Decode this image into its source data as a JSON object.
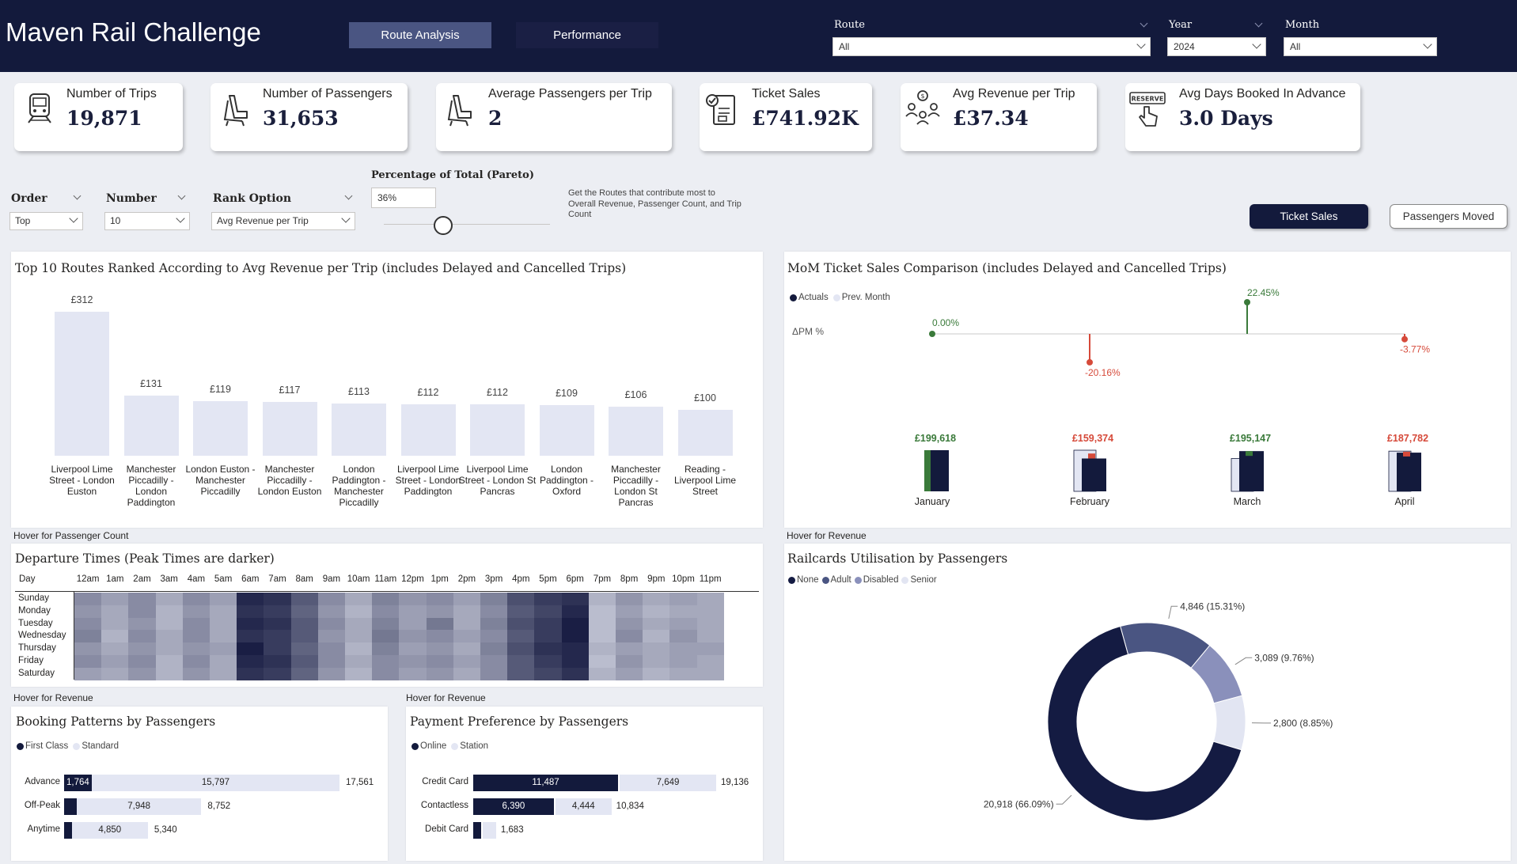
{
  "header": {
    "title": "Maven Rail Challenge",
    "tabs": [
      "Route Analysis",
      "Performance"
    ],
    "slicers": {
      "route": {
        "label": "Route",
        "value": "All"
      },
      "year": {
        "label": "Year",
        "value": "2024"
      },
      "month": {
        "label": "Month",
        "value": "All"
      }
    }
  },
  "kpis": [
    {
      "label": "Number of Trips",
      "value": "19,871",
      "icon": "train-icon"
    },
    {
      "label": "Number of Passengers",
      "value": "31,653",
      "icon": "seat-icon"
    },
    {
      "label": "Average Passengers per Trip",
      "value": "2",
      "icon": "seat-icon"
    },
    {
      "label": "Ticket Sales",
      "value": "£741.92K",
      "icon": "ticket-icon"
    },
    {
      "label": "Avg Revenue per Trip",
      "value": "£37.34",
      "icon": "people-money-icon"
    },
    {
      "label": "Avg Days Booked In Advance",
      "value": "3.0 Days",
      "icon": "reserve-icon"
    }
  ],
  "controls": {
    "order": {
      "label": "Order",
      "value": "Top"
    },
    "number": {
      "label": "Number",
      "value": "10"
    },
    "rank": {
      "label": "Rank Option",
      "value": "Avg Revenue per Trip"
    },
    "pareto": {
      "label": "Percentage of Total (Pareto)",
      "value": "36%"
    },
    "note": "Get the Routes that contribute most to Overall Revenue, Passenger Count, and Trip Count",
    "toggle": [
      "Ticket Sales",
      "Passengers Moved"
    ]
  },
  "top_routes": {
    "title": "Top 10 Routes Ranked According to Avg Revenue per Trip (includes Delayed and Cancelled Trips)",
    "hover": "Hover for Passenger Count",
    "routes": [
      {
        "name": "Liverpool Lime Street - London Euston",
        "label": "£312",
        "value": 312
      },
      {
        "name": "Manchester Piccadilly - London Paddington",
        "label": "£131",
        "value": 131
      },
      {
        "name": "London Euston - Manchester Piccadilly",
        "label": "£119",
        "value": 119
      },
      {
        "name": "Manchester Piccadilly - London Euston",
        "label": "£117",
        "value": 117
      },
      {
        "name": "London Paddington - Manchester Piccadilly",
        "label": "£113",
        "value": 113
      },
      {
        "name": "Liverpool Lime Street - London Paddington",
        "label": "£112",
        "value": 112
      },
      {
        "name": "Liverpool Lime Street - London St Pancras",
        "label": "£112",
        "value": 112
      },
      {
        "name": "London Paddington - Oxford",
        "label": "£109",
        "value": 109
      },
      {
        "name": "Manchester Piccadilly - London St Pancras",
        "label": "£106",
        "value": 106
      },
      {
        "name": "Reading - Liverpool Lime Street",
        "label": "£100",
        "value": 100
      }
    ]
  },
  "mom": {
    "title": "MoM Ticket Sales Comparison (includes Delayed and Cancelled Trips)",
    "legend": [
      "Actuals",
      "Prev. Month"
    ],
    "pm_label": "ΔPM %",
    "hover": "Hover for Revenue",
    "months": [
      {
        "name": "January",
        "actual": 199618,
        "actual_label": "£199,618",
        "prev": 0,
        "pct": 0.0,
        "pct_label": "0.00%",
        "color": "#3a7a3a"
      },
      {
        "name": "February",
        "actual": 159374,
        "actual_label": "£159,374",
        "prev": 199618,
        "pct": -20.16,
        "pct_label": "-20.16%",
        "color": "#d64a3a"
      },
      {
        "name": "March",
        "actual": 195147,
        "actual_label": "£195,147",
        "prev": 159374,
        "pct": 22.45,
        "pct_label": "22.45%",
        "color": "#3a7a3a"
      },
      {
        "name": "April",
        "actual": 187782,
        "actual_label": "£187,782",
        "prev": 195147,
        "pct": -3.77,
        "pct_label": "-3.77%",
        "color": "#d64a3a"
      }
    ]
  },
  "departures": {
    "title": "Departure Times (Peak Times are darker)",
    "hover": "Hover for Revenue",
    "corner": "Day",
    "hours": [
      "12am",
      "1am",
      "2am",
      "3am",
      "4am",
      "5am",
      "6am",
      "7am",
      "8am",
      "9am",
      "10am",
      "11am",
      "12pm",
      "1pm",
      "2pm",
      "3pm",
      "4pm",
      "5pm",
      "6pm",
      "7pm",
      "8pm",
      "9pm",
      "10pm",
      "11pm"
    ],
    "days": [
      "Sunday",
      "Monday",
      "Tuesday",
      "Wednesday",
      "Thursday",
      "Friday",
      "Saturday"
    ],
    "intensity": [
      [
        0.45,
        0.35,
        0.45,
        0.3,
        0.45,
        0.35,
        0.95,
        0.9,
        0.7,
        0.45,
        0.3,
        0.5,
        0.4,
        0.45,
        0.35,
        0.5,
        0.75,
        0.85,
        0.9,
        0.25,
        0.4,
        0.3,
        0.35,
        0.3
      ],
      [
        0.4,
        0.3,
        0.45,
        0.25,
        0.4,
        0.3,
        0.9,
        0.85,
        0.65,
        0.4,
        0.25,
        0.45,
        0.35,
        0.4,
        0.3,
        0.45,
        0.7,
        0.8,
        0.95,
        0.2,
        0.35,
        0.25,
        0.3,
        0.3
      ],
      [
        0.45,
        0.3,
        0.4,
        0.25,
        0.45,
        0.3,
        0.95,
        0.9,
        0.7,
        0.45,
        0.3,
        0.5,
        0.35,
        0.55,
        0.3,
        0.5,
        0.75,
        0.85,
        1.0,
        0.2,
        0.4,
        0.3,
        0.35,
        0.3
      ],
      [
        0.5,
        0.25,
        0.45,
        0.3,
        0.45,
        0.3,
        0.9,
        0.85,
        0.7,
        0.4,
        0.3,
        0.55,
        0.4,
        0.45,
        0.35,
        0.45,
        0.7,
        0.85,
        1.0,
        0.2,
        0.45,
        0.25,
        0.4,
        0.3
      ],
      [
        0.4,
        0.3,
        0.4,
        0.3,
        0.4,
        0.35,
        1.0,
        0.85,
        0.65,
        0.45,
        0.25,
        0.5,
        0.35,
        0.4,
        0.3,
        0.5,
        0.75,
        0.9,
        0.95,
        0.25,
        0.35,
        0.3,
        0.35,
        0.35
      ],
      [
        0.45,
        0.35,
        0.45,
        0.25,
        0.45,
        0.3,
        0.95,
        0.9,
        0.7,
        0.45,
        0.3,
        0.45,
        0.4,
        0.45,
        0.35,
        0.45,
        0.7,
        0.85,
        0.95,
        0.2,
        0.4,
        0.3,
        0.35,
        0.3
      ],
      [
        0.35,
        0.3,
        0.4,
        0.25,
        0.4,
        0.3,
        0.9,
        0.85,
        0.65,
        0.4,
        0.25,
        0.45,
        0.35,
        0.4,
        0.3,
        0.45,
        0.7,
        0.8,
        0.9,
        0.25,
        0.35,
        0.25,
        0.3,
        0.3
      ]
    ]
  },
  "booking": {
    "title": "Booking Patterns by Passengers",
    "legend": [
      "First Class",
      "Standard"
    ],
    "rows": [
      {
        "label": "Advance",
        "first": 1764,
        "first_label": "1,764",
        "standard": 15797,
        "standard_label": "15,797",
        "total_label": "17,561"
      },
      {
        "label": "Off-Peak",
        "first": 804,
        "first_label": "",
        "standard": 7948,
        "standard_label": "7,948",
        "total_label": "8,752"
      },
      {
        "label": "Anytime",
        "first": 490,
        "first_label": "",
        "standard": 4850,
        "standard_label": "4,850",
        "total_label": "5,340"
      }
    ]
  },
  "payment": {
    "title": "Payment Preference by Passengers",
    "hover": "Hover for Revenue",
    "legend": [
      "Online",
      "Station"
    ],
    "rows": [
      {
        "label": "Credit Card",
        "online": 11487,
        "online_label": "11,487",
        "station": 7649,
        "station_label": "7,649",
        "total_label": "19,136"
      },
      {
        "label": "Contactless",
        "online": 6390,
        "online_label": "6,390",
        "station": 4444,
        "station_label": "4,444",
        "total_label": "10,834"
      },
      {
        "label": "Debit Card",
        "online": 626,
        "online_label": "",
        "station": 1057,
        "station_label": "",
        "total_label": "1,683"
      }
    ]
  },
  "railcards": {
    "title": "Railcards Utilisation by Passengers",
    "legend": [
      "None",
      "Adult",
      "Disabled",
      "Senior"
    ],
    "slices": [
      {
        "name": "None",
        "value": 20918,
        "label": "20,918 (66.09%)",
        "color": "#141b42"
      },
      {
        "name": "Adult",
        "value": 4846,
        "label": "4,846 (15.31%)",
        "color": "#4a5582"
      },
      {
        "name": "Disabled",
        "value": 3089,
        "label": "3,089 (9.76%)",
        "color": "#8a90bb"
      },
      {
        "name": "Senior",
        "value": 2800,
        "label": "2,800 (8.85%)",
        "color": "#e2e5f2"
      }
    ]
  },
  "colors": {
    "navy": "#131a3c",
    "accent": "#4a5582",
    "barlight": "#e3e6f3",
    "green": "#3a7a3a",
    "red": "#d64a3a"
  }
}
